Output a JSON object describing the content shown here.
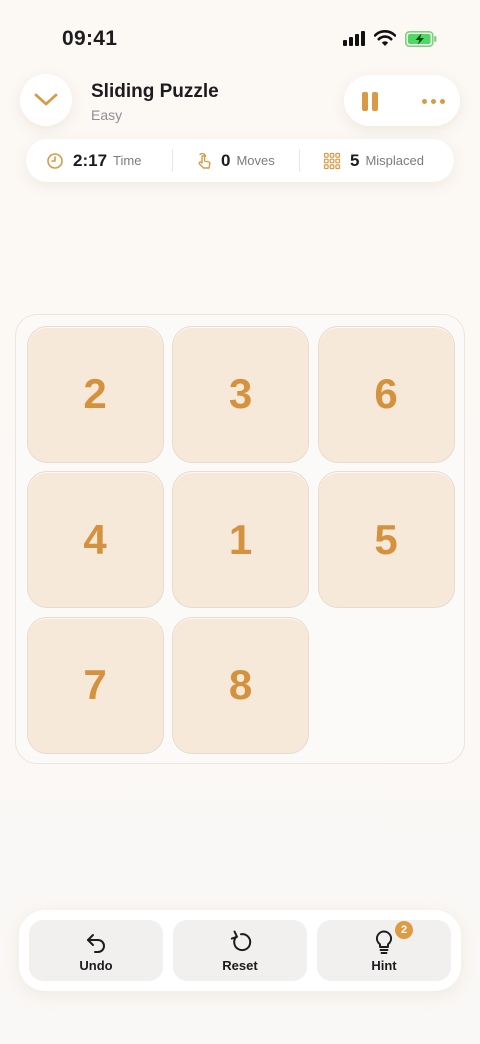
{
  "status_bar": {
    "time": "09:41"
  },
  "header": {
    "title": "Sliding Puzzle",
    "difficulty": "Easy"
  },
  "stats": {
    "time": {
      "value": "2:17",
      "label": "Time",
      "icon": "clock-icon"
    },
    "moves": {
      "value": "0",
      "label": "Moves",
      "icon": "tap-hand-icon"
    },
    "misplaced": {
      "value": "5",
      "label": "Misplaced",
      "icon": "grid-icon"
    }
  },
  "board": {
    "rows": 3,
    "cols": 3,
    "tiles": [
      "2",
      "3",
      "6",
      "4",
      "1",
      "5",
      "7",
      "8",
      ""
    ]
  },
  "toolbar": {
    "undo": {
      "label": "Undo",
      "icon": "undo-arrow-icon"
    },
    "reset": {
      "label": "Reset",
      "icon": "reset-icon"
    },
    "hint": {
      "label": "Hint",
      "icon": "lightbulb-icon",
      "badge": "2"
    }
  },
  "colors": {
    "accent": "#d99a45",
    "tile_bg": "#f6e9d9",
    "tile_text": "#d4923f",
    "background": "#fbf8f5"
  }
}
